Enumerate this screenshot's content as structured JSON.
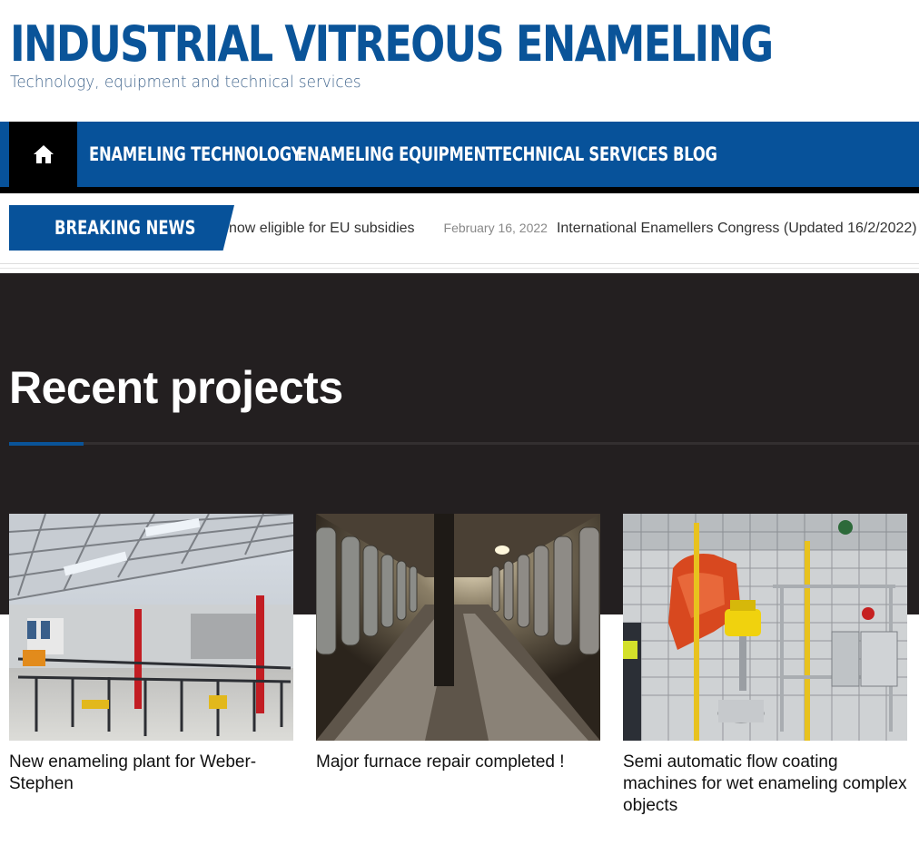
{
  "header": {
    "site_title": "INDUSTRIAL VITREOUS ENAMELING",
    "tagline": "Technology, equipment and technical services"
  },
  "nav": {
    "home_icon": "home-icon",
    "items": [
      {
        "label": "ENAMELING TECHNOLOGY"
      },
      {
        "label": "ENAMELING EQUIPMENT"
      },
      {
        "label": "TECHNICAL SERVICES"
      },
      {
        "label": "BLOG"
      }
    ]
  },
  "ticker": {
    "label": "BREAKING NEWS",
    "items": [
      {
        "text": "now eligible for EU subsidies"
      },
      {
        "date": "February 16, 2022",
        "text": "International Enamellers Congress (Updated 16/2/2022)"
      }
    ]
  },
  "recent": {
    "title": "Recent projects",
    "cards": [
      {
        "title": "New enameling plant for Weber-Stephen",
        "image": "factory-hall-photo"
      },
      {
        "title": "Major furnace repair completed !",
        "image": "furnace-tunnel-photo"
      },
      {
        "title": "Semi automatic flow coating machines for wet enameling complex objects",
        "image": "flow-coating-machine-photo"
      }
    ]
  },
  "colors": {
    "brand_blue": "#07529a",
    "dark_bg": "#231f20",
    "nav_home_bg": "#000000"
  }
}
